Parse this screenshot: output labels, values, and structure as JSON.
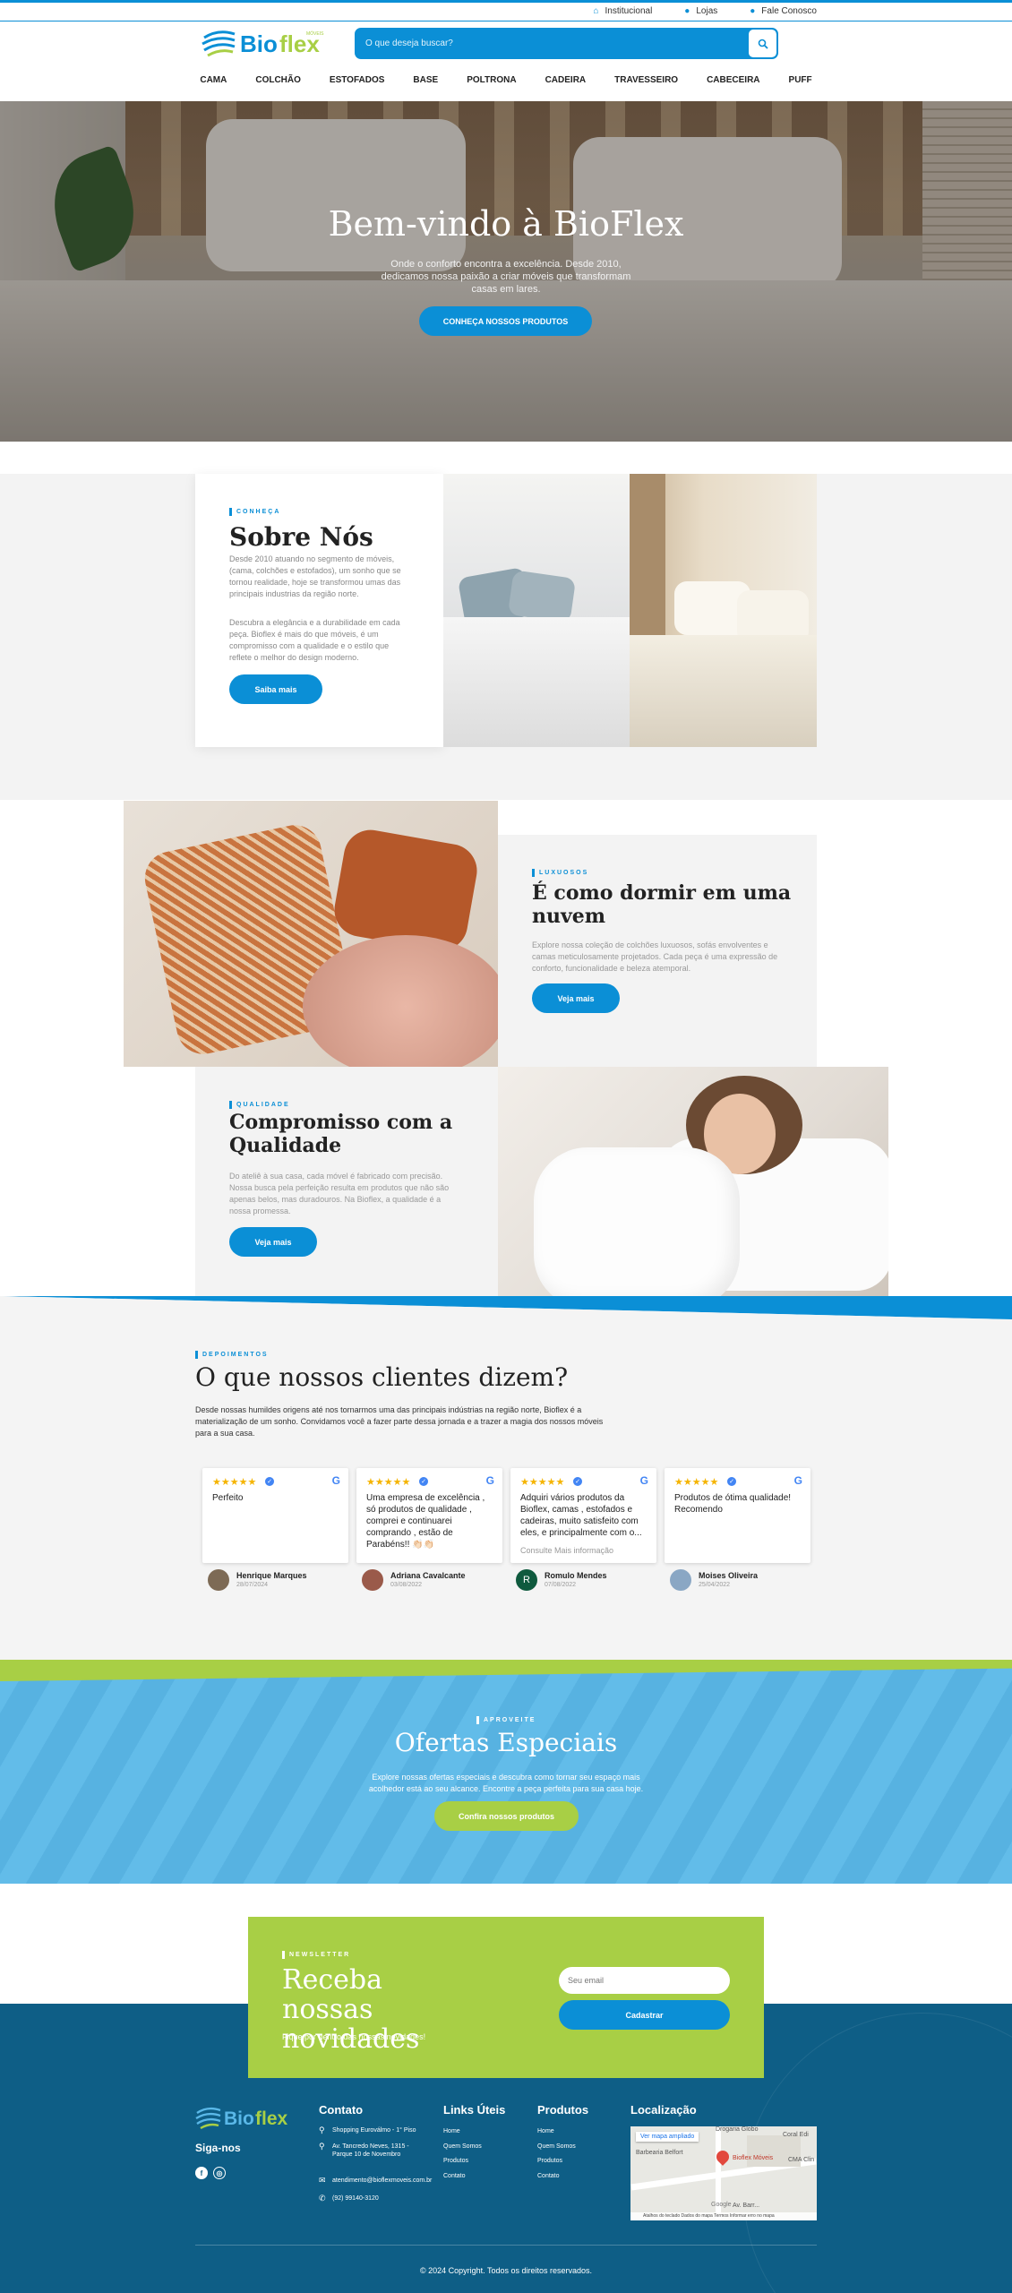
{
  "topbar": {
    "links": [
      {
        "icon": "home-icon",
        "label": "Institucional"
      },
      {
        "icon": "map-pin-icon",
        "label": "Lojas"
      },
      {
        "icon": "user-icon",
        "label": "Fale Conosco"
      }
    ]
  },
  "header": {
    "logo_text": "Bioflex",
    "logo_sub": "MÓVEIS",
    "search_placeholder": "O que deseja buscar?"
  },
  "nav": [
    "CAMA",
    "COLCHÃO",
    "ESTOFADOS",
    "BASE",
    "POLTRONA",
    "CADEIRA",
    "TRAVESSEIRO",
    "CABECEIRA",
    "PUFF"
  ],
  "hero": {
    "title": "Bem-vindo à BioFlex",
    "text": "Onde o conforto encontra a excelência. Desde 2010, dedicamos nossa paixão a criar móveis que transformam casas em lares.",
    "cta": "CONHEÇA NOSSOS PRODUTOS"
  },
  "about": {
    "tag": "CONHEÇA",
    "title": "Sobre Nós",
    "p1": "Desde 2010 atuando no segmento de móveis, (cama, colchões e estofados), um sonho que se tornou realidade, hoje se transformou umas das principais industrias da região norte.",
    "p2": "Descubra a elegância e a durabilidade em cada peça. Bioflex é mais do que móveis, é um compromisso com a qualidade e o estilo que reflete o melhor do design moderno.",
    "cta": "Saiba mais"
  },
  "cloud": {
    "tag": "LUXUOSOS",
    "title": "É como dormir em uma nuvem",
    "text": "Explore nossa coleção de colchões luxuosos, sofás envolventes e camas meticulosamente projetados. Cada peça é uma expressão de conforto, funcionalidade e beleza atemporal.",
    "cta": "Veja mais"
  },
  "quality": {
    "tag": "QUALIDADE",
    "title": "Compromisso com a Qualidade",
    "text": "Do ateliê à sua casa, cada móvel é fabricado com precisão. Nossa busca pela perfeição resulta em produtos que não são apenas belos, mas duradouros. Na Bioflex, a qualidade é a nossa promessa.",
    "cta": "Veja mais"
  },
  "testimonials": {
    "tag": "DEPOIMENTOS",
    "title": "O que nossos clientes dizem?",
    "lead": "Desde nossas humildes origens até nos tornarmos uma das principais indústrias na região norte, Bioflex é a materialização de um sonho. Convidamos você a fazer parte dessa jornada e a trazer a magia dos nossos móveis para a sua casa.",
    "stars": "★★★★★",
    "reviews": [
      {
        "text": "Perfeito",
        "more": "",
        "name": "Henrique Marques",
        "date": "28/07/2024",
        "avatar_color": "#7d6a55"
      },
      {
        "text": "Uma empresa de excelência , só produtos de qualidade , comprei e continuarei comprando , estão de Parabéns!! 👏🏻👏🏻",
        "more": "",
        "name": "Adriana Cavalcante",
        "date": "03/08/2022",
        "avatar_color": "#9a5a4a"
      },
      {
        "text": "Adquiri vários produtos da Bioflex, camas , estofados e cadeiras, muito satisfeito com eles, e principalmente com o...",
        "more": "Consulte Mais informação",
        "name": "Romulo Mendes",
        "date": "07/08/2022",
        "avatar_color": "#0f5a3e",
        "initial": "R"
      },
      {
        "text": "Produtos de ótima qualidade! Recomendo",
        "more": "",
        "name": "Moises Oliveira",
        "date": "25/04/2022",
        "avatar_color": "#8aa7c4"
      }
    ]
  },
  "offers": {
    "tag": "APROVEITE",
    "title": "Ofertas Especiais",
    "text": "Explore nossas ofertas especiais e descubra como tornar seu espaço mais acolhedor está ao seu alcance. Encontre a peça perfeita para sua casa hoje.",
    "cta": "Confira nossos produtos"
  },
  "newsletter": {
    "tag": "NEWSLETTER",
    "title": "Receba nossas novidades",
    "text": "Fique por dentro das nossas novidades!",
    "placeholder": "Seu email",
    "cta": "Cadastrar"
  },
  "footer": {
    "follow": "Siga-nos",
    "contact_title": "Contato",
    "contact": [
      {
        "icon": "map-pin-icon",
        "text": "Shopping Euroválmo - 1° Piso"
      },
      {
        "icon": "map-pin-icon",
        "text": "Av. Tancredo Neves, 1315 - Parque 10 de Novembro"
      },
      {
        "icon": "mail-icon",
        "text": "atendimento@bioflexmoveis.com.br"
      },
      {
        "icon": "phone-icon",
        "text": "(92) 99140-3120"
      }
    ],
    "links_title": "Links Úteis",
    "links": [
      "Home",
      "Quem Somos",
      "Produtos",
      "Contato"
    ],
    "products_title": "Produtos",
    "products": [
      "Home",
      "Quem Somos",
      "Produtos",
      "Contato"
    ],
    "location_title": "Localização",
    "map": {
      "view_larger": "Ver mapa ampliado",
      "place": "Bioflex Móveis",
      "label_left": "Barbearia Belfort",
      "label_top": "Drogaria Globo",
      "label_right": "Coral Edi",
      "label_right2": "CMA Clin",
      "street": "Av. Barr...",
      "attribution": "Atalhos do teclado   Dados do mapa   Termos   Informar erro no mapa",
      "google": "Google"
    },
    "copyright": "© 2024 Copyright. Todos os direitos reservados."
  },
  "colors": {
    "primary": "#0b8fd6",
    "green": "#a8cf45",
    "footer": "#0e5e86"
  }
}
